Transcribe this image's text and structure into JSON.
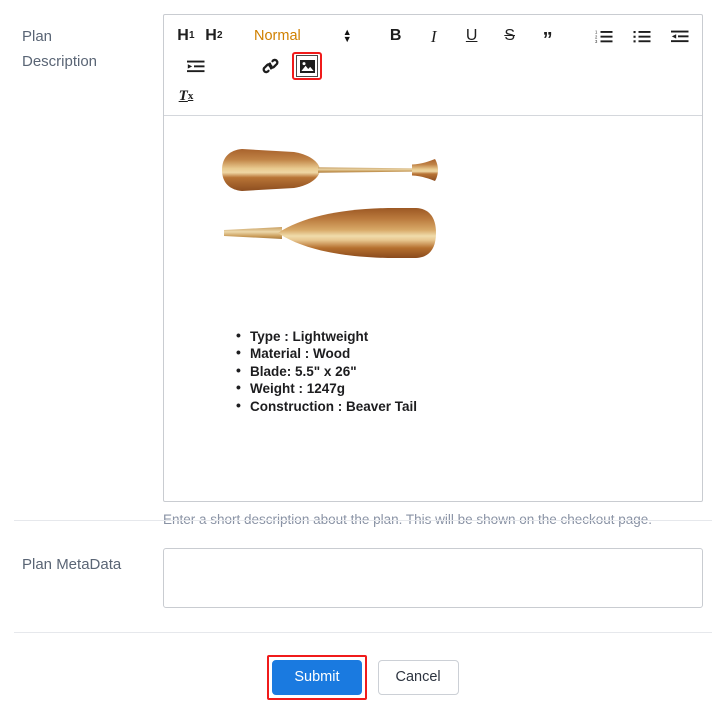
{
  "form": {
    "description_field": {
      "label_line1": "Plan",
      "label_line2": "Description",
      "help_text": "Enter a short description about the plan. This will be shown on the checkout page."
    },
    "metadata_field": {
      "label": "Plan MetaData",
      "value": "",
      "placeholder": ""
    }
  },
  "editor": {
    "toolbar": {
      "heading1": "H",
      "heading1_sub": "1",
      "heading2": "H",
      "heading2_sub": "2",
      "size_picker_value": "Normal",
      "size_picker_color": "#d08000",
      "bold": "B",
      "italic": "I",
      "underline": "U",
      "strike": "S",
      "blockquote": "”",
      "clear_format": "T",
      "clear_format_sub": "x",
      "icons": {
        "ordered_list": "ordered-list-icon",
        "bullet_list": "bullet-list-icon",
        "outdent": "outdent-icon",
        "indent": "indent-icon",
        "link": "link-icon",
        "image": "image-icon"
      },
      "highlight_color": "#f01b1b",
      "highlighted_button": "image-icon"
    },
    "content": {
      "image_alt": "Two wooden canoe paddles",
      "spec_items": [
        "Type : Lightweight",
        "Material : Wood",
        "Blade: 5.5\" x 26\"",
        "Weight : 1247g",
        "Construction : Beaver Tail"
      ]
    }
  },
  "actions": {
    "submit_label": "Submit",
    "cancel_label": "Cancel",
    "submit_color": "#1a7ae0",
    "submit_highlight_color": "#f01b1b"
  }
}
